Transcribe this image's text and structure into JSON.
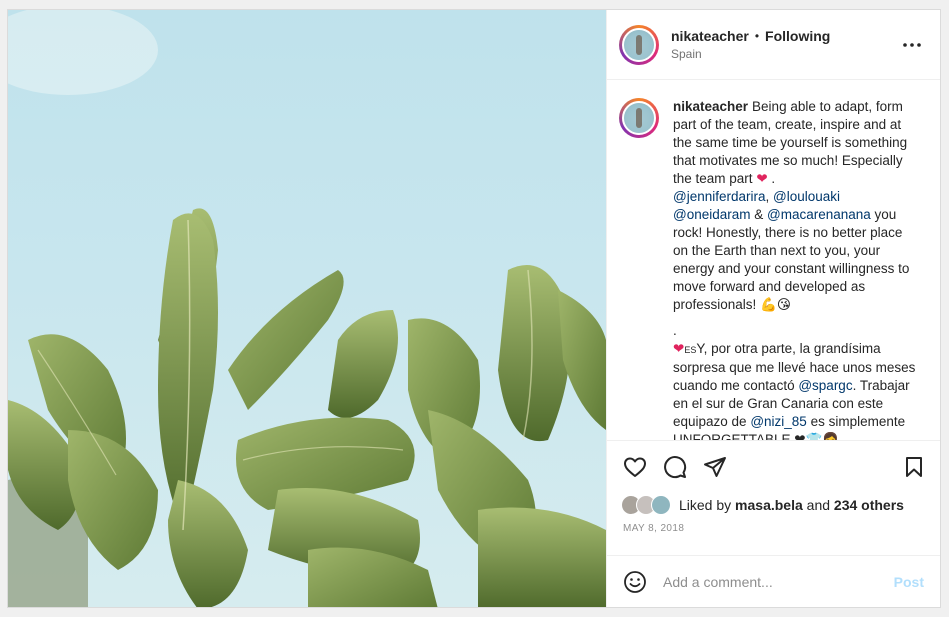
{
  "post": {
    "username": "nikateacher",
    "separator": "•",
    "follow_status": "Following",
    "location": "Spain",
    "caption": {
      "p1": "Being able to adapt, form part of the team, create, inspire and at the same time be yourself is something that motivates me so much! Especially the team part",
      "p1_emoji": "❤",
      "p1_end": ".",
      "mentions_line": {
        "m1": "@jenniferdarira",
        "sep1": ", ",
        "m2": "@loulouaki",
        "m3": "@oneidaram",
        "amp": " & ",
        "m4": "@macarenanana",
        "after": " you rock! Honestly, there is no better place on the Earth than next to you, your energy and your constant willingness to move forward and developed as professionals!",
        "emojis": "💪😘"
      },
      "dot_line": ".",
      "p2_flag": "❤",
      "p2_es": "ES",
      "p2a": "Y, por otra parte, la grandísima sorpresa que me llevé hace unos meses cuando me contactó ",
      "p2_m1": "@spargc",
      "p2b": ". Trabajar en el sur de Gran Canaria con este equipazo de ",
      "p2_m2": "@nizi_85",
      "p2c": " es simplemente UNFORGETTABLE ",
      "p2_emojis": "❤👕👩"
    },
    "likes": {
      "prefix": "Liked by",
      "user": "masa.bela",
      "connector": "and",
      "others": "234 others"
    },
    "date": "MAY 8, 2018",
    "comment": {
      "placeholder": "Add a comment...",
      "post_label": "Post"
    }
  },
  "icons": {
    "more": "more-horizontal-icon",
    "like": "heart-icon",
    "comment": "comment-icon",
    "share": "share-icon",
    "save": "bookmark-icon",
    "emoji": "emoji-icon"
  },
  "colors": {
    "link": "#00376b",
    "post_button": "#b2dffc",
    "muted": "#8e8e8e"
  }
}
